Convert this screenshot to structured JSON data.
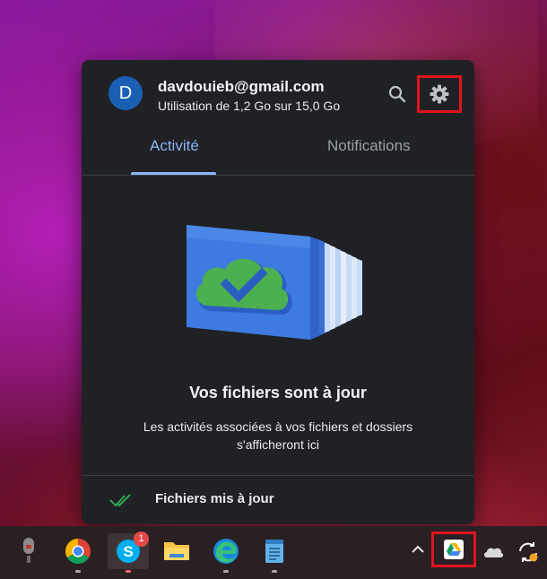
{
  "account": {
    "avatar_letter": "D",
    "email": "davdouieb@gmail.com",
    "usage": "Utilisation de 1,2 Go sur 15,0 Go"
  },
  "header_icons": {
    "search": "search-icon",
    "settings": "gear-icon"
  },
  "tabs": [
    {
      "label": "Activité",
      "active": true
    },
    {
      "label": "Notifications",
      "active": false
    }
  ],
  "main": {
    "headline": "Vos fichiers sont à jour",
    "description": "Les activités associées à vos fichiers et dossiers s'afficheront ici"
  },
  "status": {
    "text": "Fichiers mis à jour",
    "icon": "double-check-icon"
  },
  "taskbar": {
    "apps": [
      {
        "name": "microphone-app-icon",
        "running": false
      },
      {
        "name": "chrome-icon",
        "running": true
      },
      {
        "name": "skype-icon",
        "running": true,
        "badge": "1"
      },
      {
        "name": "file-explorer-icon",
        "running": false
      },
      {
        "name": "edge-icon",
        "running": true
      },
      {
        "name": "notepad-icon",
        "running": true
      }
    ],
    "tray": [
      "chevron-up-icon",
      "google-drive-icon",
      "onedrive-cloud-icon",
      "sync-icon"
    ]
  },
  "colors": {
    "accent": "#8ab4f8",
    "highlight_box": "#e0141e",
    "panel_bg": "#202124",
    "avatar": "#1a5fb4",
    "check": "#34a853"
  }
}
